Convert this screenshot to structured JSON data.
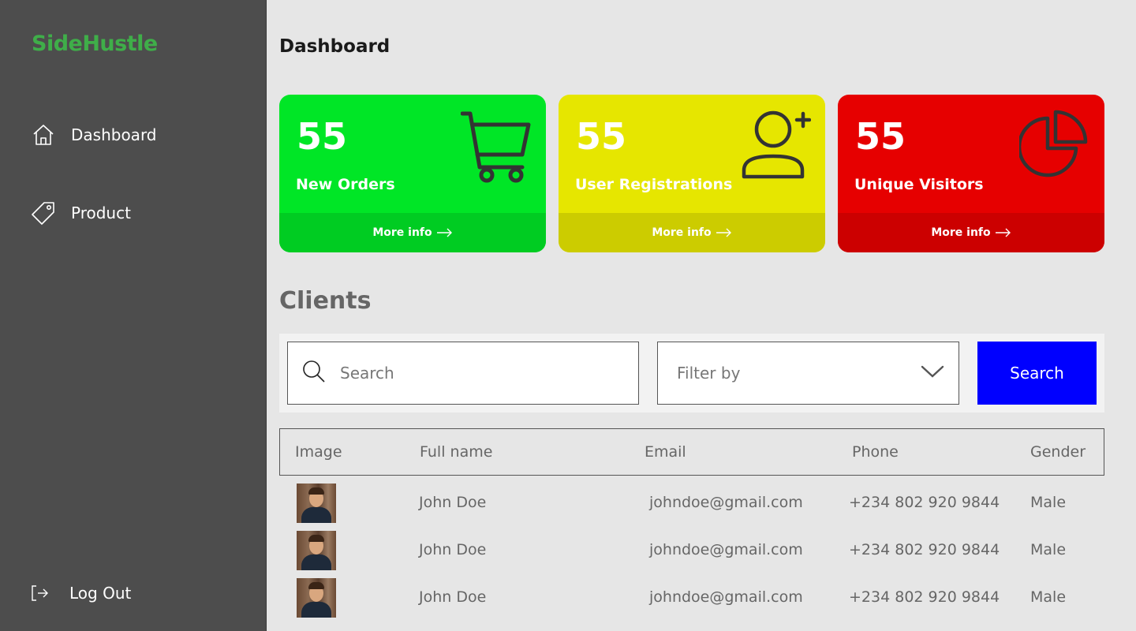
{
  "sidebar": {
    "logo": "SideHustle",
    "items": [
      {
        "label": "Dashboard",
        "icon": "home-icon"
      },
      {
        "label": "Product",
        "icon": "tag-icon"
      }
    ],
    "logout_label": "Log Out"
  },
  "page": {
    "title": "Dashboard"
  },
  "cards": [
    {
      "count": "55",
      "label": "New Orders",
      "footer": "More info",
      "icon": "cart-icon",
      "color": "#00e626"
    },
    {
      "count": "55",
      "label": "User Registrations",
      "footer": "More info",
      "icon": "user-plus-icon",
      "color": "#e6e600"
    },
    {
      "count": "55",
      "label": "Unique Visitors",
      "footer": "More info",
      "icon": "pie-chart-icon",
      "color": "#e60000"
    }
  ],
  "clients": {
    "title": "Clients",
    "search_placeholder": "Search",
    "filter_label": "Filter by",
    "search_button": "Search",
    "columns": [
      "Image",
      "Full name",
      "Email",
      "Phone",
      "Gender"
    ],
    "rows": [
      {
        "name": "John Doe",
        "email": "johndoe@gmail.com",
        "phone": "+234 802 920 9844",
        "gender": "Male"
      },
      {
        "name": "John Doe",
        "email": "johndoe@gmail.com",
        "phone": "+234 802 920 9844",
        "gender": "Male"
      },
      {
        "name": "John Doe",
        "email": "johndoe@gmail.com",
        "phone": "+234 802 920 9844",
        "gender": "Male"
      }
    ]
  },
  "colors": {
    "accent_button": "#0000ff",
    "sidebar": "#4d4d4d",
    "logo": "#3fae49"
  }
}
